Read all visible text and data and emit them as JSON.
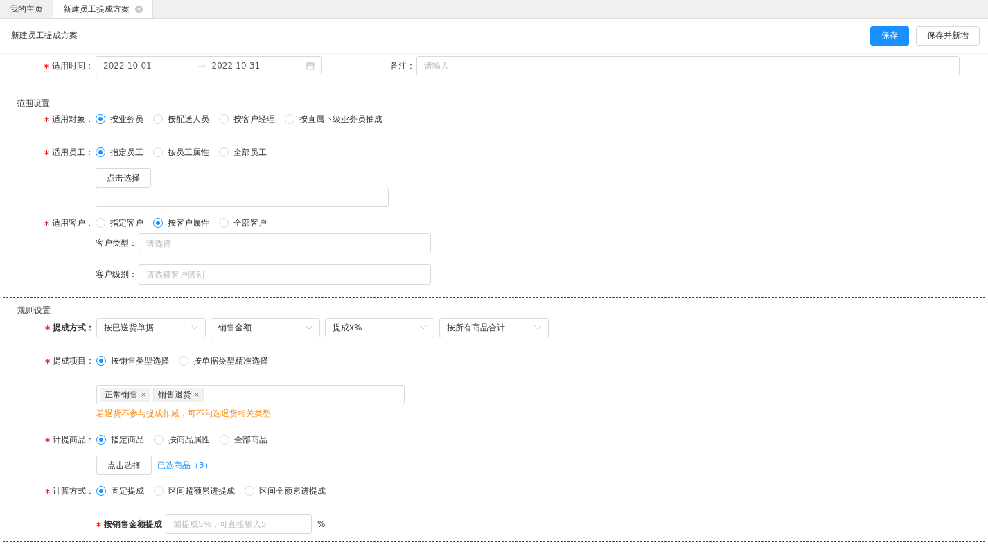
{
  "tabs": [
    {
      "label": "我的主页",
      "selected": false,
      "closable": false
    },
    {
      "label": "新建员工提成方案",
      "selected": true,
      "closable": true
    }
  ],
  "page_title": "新建员工提成方案",
  "buttons": [
    {
      "label": "保存",
      "kind": "primary"
    },
    {
      "label": "保存并新增",
      "kind": "default"
    }
  ],
  "period": {
    "label": "适用时间：",
    "required": true,
    "start": "2022-10-01",
    "end": "2022-10-31"
  },
  "remark": {
    "label": "备注：",
    "placeholder": "请输入"
  },
  "sections": [
    {
      "title": "范围设置",
      "rows": [
        {
          "kind": "radio",
          "label": "适用对象：",
          "required": true,
          "options": [
            {
              "label": "按业务员",
              "selected": true
            },
            {
              "label": "按配送人员",
              "selected": false
            },
            {
              "label": "按客户经理",
              "selected": false
            },
            {
              "label": "按直属下级业务员抽成",
              "selected": false
            }
          ]
        },
        {
          "kind": "radio",
          "label": "适用员工：",
          "required": true,
          "options": [
            {
              "label": "指定员工",
              "selected": true
            },
            {
              "label": "按员工属性",
              "selected": false
            },
            {
              "label": "全部员工",
              "selected": false
            }
          ],
          "select_button": "点击选择",
          "empty_field": true
        },
        {
          "kind": "radio",
          "label": "适用客户：",
          "required": true,
          "options": [
            {
              "label": "指定客户",
              "selected": false
            },
            {
              "label": "按客户属性",
              "selected": true
            },
            {
              "label": "全部客户",
              "selected": false
            }
          ],
          "sub_fields": [
            {
              "label": "客户类型：",
              "placeholder": "请选择"
            },
            {
              "label": "客户级别：",
              "placeholder": "请选择客户级别"
            }
          ]
        }
      ]
    },
    {
      "title": "规则设置",
      "highlighted": true,
      "rows": [
        {
          "kind": "selects",
          "label": "提成方式：",
          "required": true,
          "selects": [
            "按已送货单据",
            "销售金额",
            "提成x%",
            "按所有商品合计"
          ]
        },
        {
          "kind": "radio",
          "label": "提成项目：",
          "required": true,
          "options": [
            {
              "label": "按销售类型选择",
              "selected": true
            },
            {
              "label": "按单据类型精准选择",
              "selected": false
            }
          ],
          "tags": [
            "正常销售",
            "销售退货"
          ],
          "hint": "若退货不参与提成扣减，可不勾选退货相关类型"
        },
        {
          "kind": "radio",
          "label": "计提商品：",
          "required": true,
          "options": [
            {
              "label": "指定商品",
              "selected": true
            },
            {
              "label": "按商品属性",
              "selected": false
            },
            {
              "label": "全部商品",
              "selected": false
            }
          ],
          "select_button": "点击选择",
          "selected_link": "已选商品（3）"
        },
        {
          "kind": "radio",
          "label": "计算方式：",
          "required": true,
          "options": [
            {
              "label": "固定提成",
              "selected": true
            },
            {
              "label": "区间超额累进提成",
              "selected": false
            },
            {
              "label": "区间全额累进提成",
              "selected": false
            }
          ]
        },
        {
          "kind": "rate",
          "label": "按销售金额提成",
          "required": true,
          "placeholder": "如提成5%，可直接输入5",
          "unit": "%"
        }
      ]
    }
  ]
}
